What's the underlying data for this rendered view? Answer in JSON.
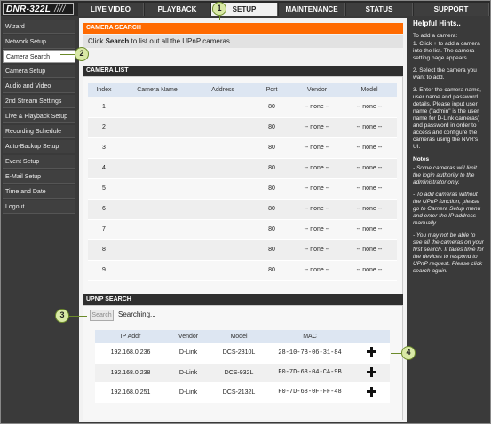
{
  "logo": {
    "text": "DNR-322L",
    "slashes": "////"
  },
  "nav": {
    "tabs": [
      {
        "label": "LIVE VIDEO"
      },
      {
        "label": "PLAYBACK"
      },
      {
        "label": "SETUP"
      },
      {
        "label": "MAINTENANCE"
      },
      {
        "label": "STATUS"
      },
      {
        "label": "SUPPORT"
      }
    ],
    "active": "SETUP"
  },
  "sidebar": {
    "items": [
      {
        "label": "Wizard"
      },
      {
        "label": "Network Setup"
      },
      {
        "label": "Camera Search"
      },
      {
        "label": "Camera Setup"
      },
      {
        "label": "Audio and Video"
      },
      {
        "label": "2nd Stream Settings"
      },
      {
        "label": "Live & Playback Setup"
      },
      {
        "label": "Recording Schedule"
      },
      {
        "label": "Auto-Backup Setup"
      },
      {
        "label": "Event Setup"
      },
      {
        "label": "E-Mail Setup"
      },
      {
        "label": "Time and Date"
      },
      {
        "label": "Logout"
      }
    ],
    "active": "Camera Search"
  },
  "camera_search": {
    "title": "CAMERA SEARCH",
    "desc_prefix": "Click ",
    "desc_bold": "Search",
    "desc_suffix": " to list out all the UPnP cameras."
  },
  "camera_list": {
    "title": "CAMERA LIST",
    "columns": [
      "Index",
      "Camera Name",
      "Address",
      "Port",
      "Vendor",
      "Model"
    ],
    "rows": [
      {
        "index": "1",
        "name": "",
        "address": "",
        "port": "80",
        "vendor": "-- none --",
        "model": "-- none --"
      },
      {
        "index": "2",
        "name": "",
        "address": "",
        "port": "80",
        "vendor": "-- none --",
        "model": "-- none --"
      },
      {
        "index": "3",
        "name": "",
        "address": "",
        "port": "80",
        "vendor": "-- none --",
        "model": "-- none --"
      },
      {
        "index": "4",
        "name": "",
        "address": "",
        "port": "80",
        "vendor": "-- none --",
        "model": "-- none --"
      },
      {
        "index": "5",
        "name": "",
        "address": "",
        "port": "80",
        "vendor": "-- none --",
        "model": "-- none --"
      },
      {
        "index": "6",
        "name": "",
        "address": "",
        "port": "80",
        "vendor": "-- none --",
        "model": "-- none --"
      },
      {
        "index": "7",
        "name": "",
        "address": "",
        "port": "80",
        "vendor": "-- none --",
        "model": "-- none --"
      },
      {
        "index": "8",
        "name": "",
        "address": "",
        "port": "80",
        "vendor": "-- none --",
        "model": "-- none --"
      },
      {
        "index": "9",
        "name": "",
        "address": "",
        "port": "80",
        "vendor": "-- none --",
        "model": "-- none --"
      }
    ]
  },
  "upnp": {
    "title": "UPNP SEARCH",
    "search_button": "Search",
    "status": "Searching...",
    "columns": [
      "IP Addr",
      "Vendor",
      "Model",
      "MAC"
    ],
    "rows": [
      {
        "ip": "192.168.0.236",
        "vendor": "D-Link",
        "model": "DCS-2310L",
        "mac": "28-10-7B-06-31-84"
      },
      {
        "ip": "192.168.0.238",
        "vendor": "D-Link",
        "model": "DCS-932L",
        "mac": "F0-7D-68-04-CA-9B"
      },
      {
        "ip": "192.168.0.251",
        "vendor": "D-Link",
        "model": "DCS-2132L",
        "mac": "F0-7D-68-0F-FF-48"
      }
    ]
  },
  "help": {
    "title": "Helpful Hints..",
    "intro": "To add a camera:",
    "steps": [
      "1. Click + to add a camera into the list. The camera setting page appears.",
      "2. Select the camera you want to add.",
      "3. Enter the camera name, user name and password details. Please input user name (\"admin\" is the user name for D-Link cameras) and password in order to access and configure the cameras using the NVR's UI."
    ],
    "notes_title": "Notes",
    "notes": [
      "- Some cameras will limit the login authority to the administrator only.",
      "- To add cameras without the UPnP function, please go to Camera Setup menu and enter the IP address manually.",
      "- You may not be able to see all the cameras on your first search. It takes time for the devices to respond to UPnP request. Please click search again."
    ]
  },
  "callouts": [
    "1",
    "2",
    "3",
    "4"
  ],
  "colors": {
    "accent": "#ff6a00",
    "dark": "#3a3a3a",
    "table_header": "#dde6f2",
    "callout_fill": "#d9e9a6"
  },
  "icons": {
    "add": "plus-icon"
  }
}
